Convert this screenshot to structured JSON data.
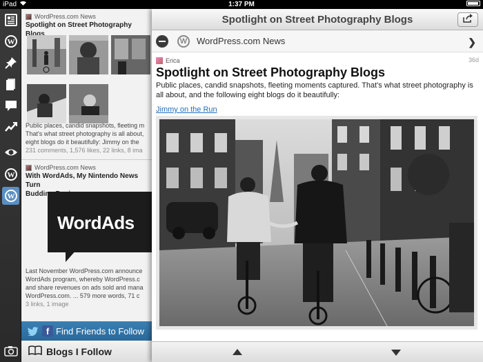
{
  "status_bar": {
    "device": "iPad",
    "time": "1:37 PM",
    "battery_percent": 95
  },
  "rail": {
    "items": [
      {
        "icon": "reader-icon",
        "active": false
      },
      {
        "icon": "wordpress-icon",
        "active": false
      },
      {
        "icon": "pin-icon",
        "active": false
      },
      {
        "icon": "posts-icon",
        "active": false
      },
      {
        "icon": "comments-icon",
        "active": false
      },
      {
        "icon": "stats-icon",
        "active": false
      },
      {
        "icon": "view-site-icon",
        "active": false
      },
      {
        "icon": "wordpress-icon",
        "active": false
      },
      {
        "icon": "wordpress-icon",
        "active": true
      }
    ],
    "camera_icon": "camera-icon"
  },
  "list": {
    "posts": [
      {
        "blog": "WordPress.com News",
        "title": "Spotlight on Street Photography Blogs",
        "excerpt": "Public places, candid snapshots, fleeting m\nThat's what street photography is all about,\neight blogs do it beautifully: Jimmy on the",
        "meta": "231 comments, 1,576 likes, 22 links, 8 ima"
      },
      {
        "blog": "WordPress.com News",
        "title": "With WordAds, My Nintendo News Turn\nBudding Business",
        "banner_text": "WordAds",
        "excerpt": "Last November WordPress.com announce\nWordAds program, whereby WordPress.c\nand share revenues on ads sold and mana\nWordPress.com. ... 579 more words, 71 c",
        "meta": "3 links, 1 image"
      }
    ],
    "find_friends_label": "Find Friends to Follow",
    "blogs_i_follow_label": "Blogs I Follow"
  },
  "detail": {
    "nav_title": "Spotlight on Street Photography Blogs",
    "blog_name": "WordPress.com News",
    "author": "Erica",
    "age": "36d",
    "title": "Spotlight on Street Photography Blogs",
    "body": "Public places, candid snapshots, fleeting moments captured. That's what street photography is all about, and the following eight blogs do it beautifully:",
    "link": "Jimmy on the Run"
  }
}
